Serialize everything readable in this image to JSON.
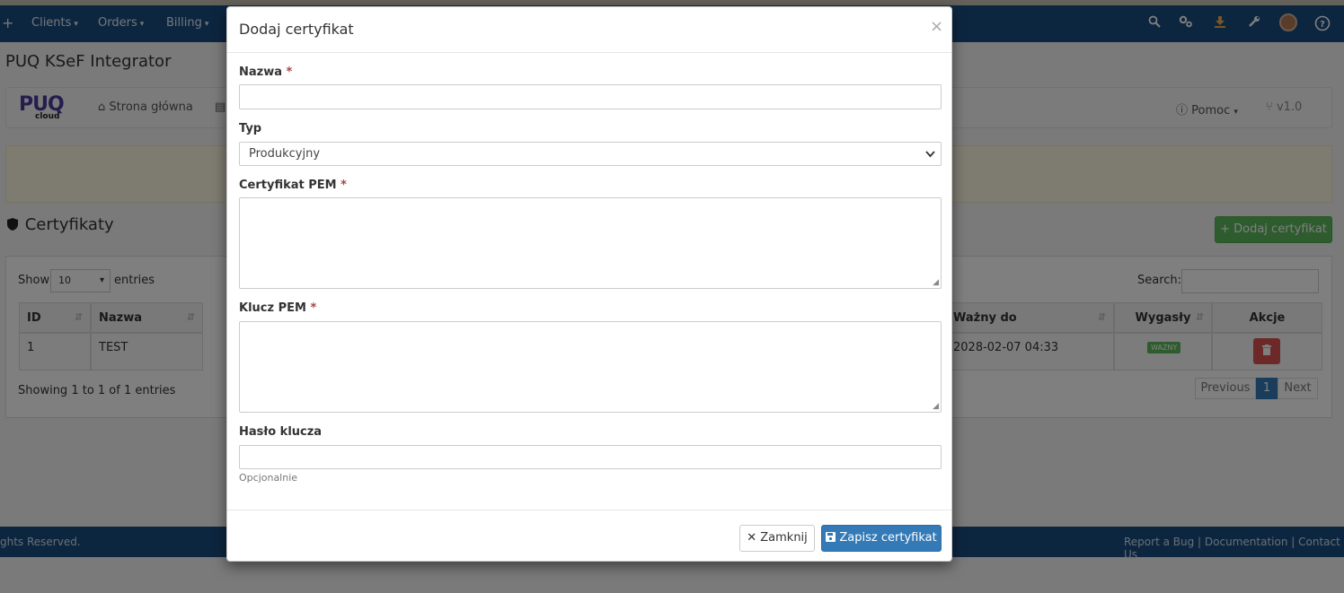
{
  "navbar": {
    "plus": "+",
    "items": [
      {
        "label": "Clients",
        "caret": "▾"
      },
      {
        "label": "Orders",
        "caret": "▾"
      },
      {
        "label": "Billing",
        "caret": "▾"
      }
    ],
    "icons": [
      "search-icon",
      "gears-icon",
      "download-icon",
      "wrench-icon",
      "avatar",
      "help-icon"
    ]
  },
  "page": {
    "title": "PUQ KSeF Integrator",
    "logo": {
      "brand": "PUQ",
      "sub": "cloud"
    },
    "module_nav": {
      "home": "Strona główna",
      "help": "Pomoc",
      "version": "v1.0"
    },
    "section_title": "Certyfikaty",
    "add_button": "+ Dodaj certyfikat"
  },
  "table": {
    "show_label": "Show",
    "show_value": "10",
    "entries_label": "entries",
    "search_label": "Search:",
    "columns": [
      "ID",
      "Nazwa",
      "Ważny do",
      "Wygasły",
      "Akcje"
    ],
    "rows": [
      {
        "id": "1",
        "name": "TEST",
        "valid_to": "2028-02-07 04:33",
        "status": "WAŻNY"
      }
    ],
    "info": "Showing 1 to 1 of 1 entries",
    "pagination": {
      "previous": "Previous",
      "current": "1",
      "next": "Next"
    }
  },
  "footer": {
    "left": "ghts Reserved.",
    "links": [
      "Report a Bug",
      "Documentation",
      "Contact Us"
    ],
    "separator": "|"
  },
  "modal": {
    "title": "Dodaj certyfikat",
    "close": "×",
    "fields": {
      "name": {
        "label": "Nazwa",
        "required": "*",
        "value": ""
      },
      "type": {
        "label": "Typ",
        "value": "Produkcyjny"
      },
      "cert_pem": {
        "label": "Certyfikat PEM",
        "required": "*",
        "value": ""
      },
      "key_pem": {
        "label": "Klucz PEM",
        "required": "*",
        "value": ""
      },
      "key_password": {
        "label": "Hasło klucza",
        "value": "",
        "hint": "Opcjonalnie"
      }
    },
    "buttons": {
      "close": "Zamknij",
      "save": "Zapisz certyfikat"
    }
  },
  "colors": {
    "navbar": "#1a4d80",
    "primary": "#337ab7",
    "success": "#5cb85c",
    "danger": "#d9534f",
    "required": "#a94442"
  }
}
